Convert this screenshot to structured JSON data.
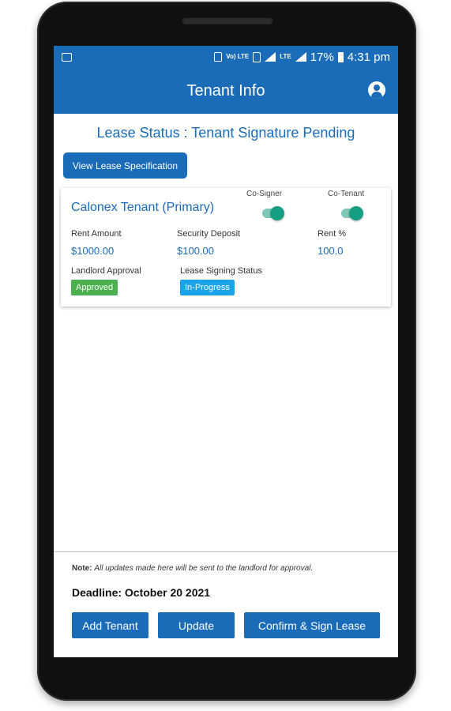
{
  "statusbar": {
    "icons": [
      "mail-notification-icon",
      "lock-icon",
      "volte-icon",
      "sim-icon",
      "signal-icon",
      "lte-icon",
      "signal-icon",
      "battery-icon"
    ],
    "volte_text": "Vo) LTE",
    "lte_text": "LTE",
    "battery": "17%",
    "time": "4:31 pm"
  },
  "appbar": {
    "title": "Tenant Info",
    "account_icon": "account-circle-icon"
  },
  "lease": {
    "status_text": "Lease Status : Tenant Signature Pending",
    "view_button": "View Lease Specification"
  },
  "tenant_card": {
    "name": "Calonex Tenant (Primary)",
    "cosigner_label": "Co-Signer",
    "cosigner_on": true,
    "cotenant_label": "Co-Tenant",
    "cotenant_on": true,
    "rent_amount_label": "Rent Amount",
    "rent_amount_value": "$1000.00",
    "security_deposit_label": "Security Deposit",
    "security_deposit_value": "$100.00",
    "rent_pct_label": "Rent %",
    "rent_pct_value": "100.0",
    "landlord_approval_label": "Landlord Approval",
    "landlord_approval_badge": "Approved",
    "lease_signing_label": "Lease Signing Status",
    "lease_signing_badge": "In-Progress"
  },
  "footer": {
    "note_label": "Note:",
    "note_text": "All updates made here will be sent to the landlord for approval.",
    "deadline": "Deadline: October 20 2021",
    "buttons": {
      "add_tenant": "Add Tenant",
      "update": "Update",
      "confirm_sign": "Confirm & Sign Lease"
    }
  },
  "colors": {
    "primary": "#1b6cb8",
    "approved_badge": "#4caf50",
    "inprogress_badge": "#1aa3e8",
    "toggle_knob": "#179f84"
  }
}
